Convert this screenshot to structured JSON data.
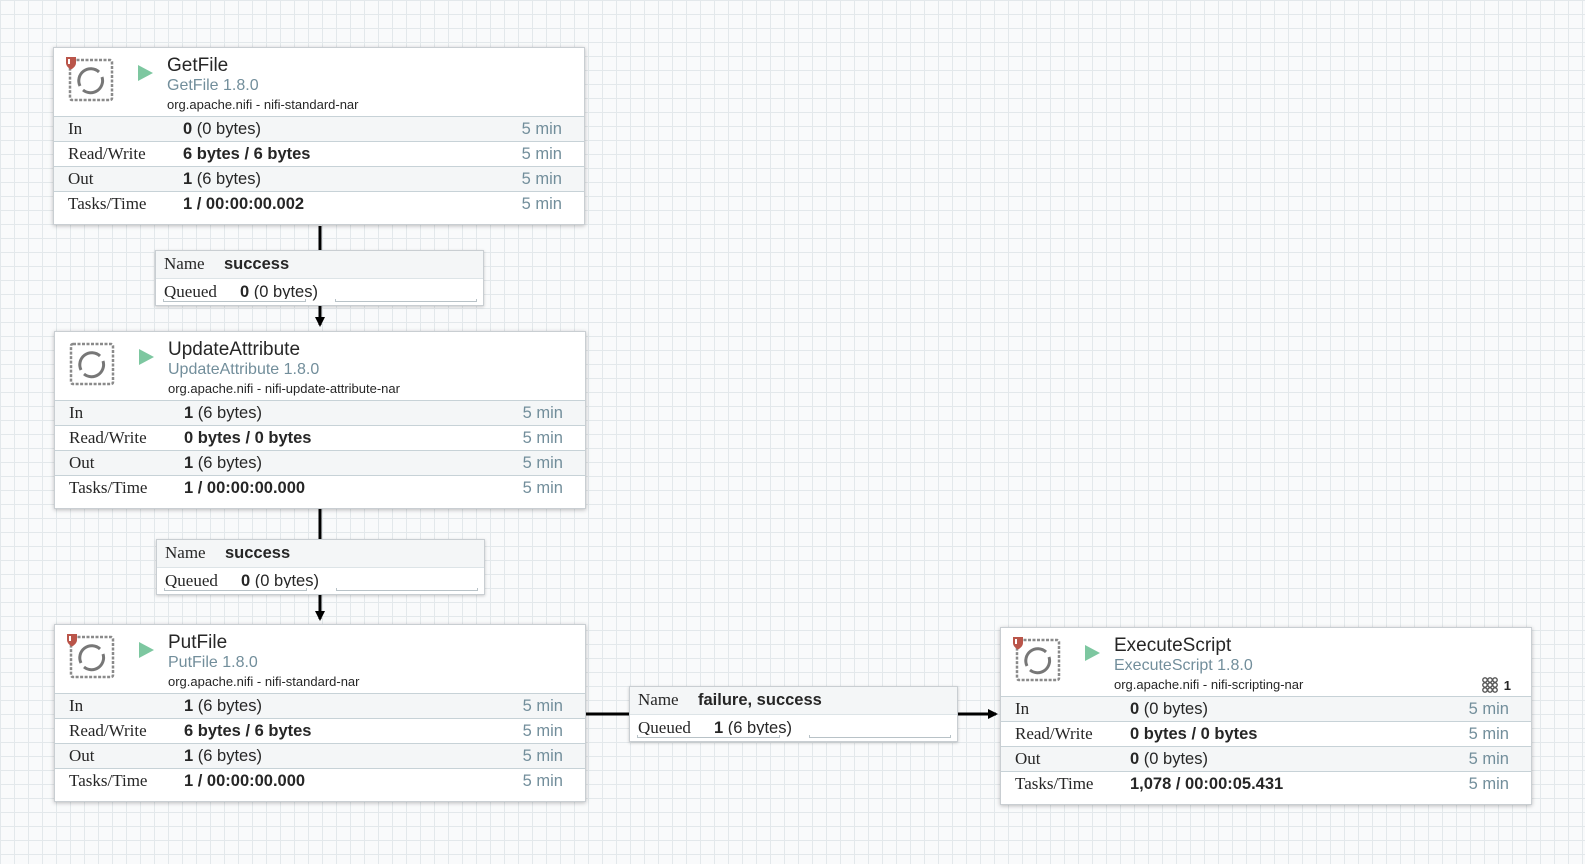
{
  "processors": [
    {
      "name": "GetFile",
      "type": "GetFile 1.8.0",
      "bundle": "org.apache.nifi - nifi-standard-nar",
      "restricted": true,
      "stats": {
        "in": {
          "label": "In",
          "count": "0",
          "size": "(0 bytes)",
          "window": "5 min"
        },
        "read_write": {
          "label": "Read/Write",
          "value": "6 bytes / 6 bytes",
          "window": "5 min"
        },
        "out": {
          "label": "Out",
          "count": "1",
          "size": "(6 bytes)",
          "window": "5 min"
        },
        "tasks_time": {
          "label": "Tasks/Time",
          "value": "1 / 00:00:00.002",
          "window": "5 min"
        }
      }
    },
    {
      "name": "UpdateAttribute",
      "type": "UpdateAttribute 1.8.0",
      "bundle": "org.apache.nifi - nifi-update-attribute-nar",
      "restricted": false,
      "stats": {
        "in": {
          "label": "In",
          "count": "1",
          "size": "(6 bytes)",
          "window": "5 min"
        },
        "read_write": {
          "label": "Read/Write",
          "value": "0 bytes / 0 bytes",
          "window": "5 min"
        },
        "out": {
          "label": "Out",
          "count": "1",
          "size": "(6 bytes)",
          "window": "5 min"
        },
        "tasks_time": {
          "label": "Tasks/Time",
          "value": "1 / 00:00:00.000",
          "window": "5 min"
        }
      }
    },
    {
      "name": "PutFile",
      "type": "PutFile 1.8.0",
      "bundle": "org.apache.nifi - nifi-standard-nar",
      "restricted": true,
      "stats": {
        "in": {
          "label": "In",
          "count": "1",
          "size": "(6 bytes)",
          "window": "5 min"
        },
        "read_write": {
          "label": "Read/Write",
          "value": "6 bytes / 6 bytes",
          "window": "5 min"
        },
        "out": {
          "label": "Out",
          "count": "1",
          "size": "(6 bytes)",
          "window": "5 min"
        },
        "tasks_time": {
          "label": "Tasks/Time",
          "value": "1 / 00:00:00.000",
          "window": "5 min"
        }
      }
    },
    {
      "name": "ExecuteScript",
      "type": "ExecuteScript 1.8.0",
      "bundle": "org.apache.nifi - nifi-scripting-nar",
      "restricted": true,
      "active_threads": "1",
      "stats": {
        "in": {
          "label": "In",
          "count": "0",
          "size": "(0 bytes)",
          "window": "5 min"
        },
        "read_write": {
          "label": "Read/Write",
          "value": "0 bytes / 0 bytes",
          "window": "5 min"
        },
        "out": {
          "label": "Out",
          "count": "0",
          "size": "(0 bytes)",
          "window": "5 min"
        },
        "tasks_time": {
          "label": "Tasks/Time",
          "value": "1,078 / 00:00:05.431",
          "window": "5 min"
        }
      }
    }
  ],
  "connections": [
    {
      "name_label": "Name",
      "name": "success",
      "queued_label": "Queued",
      "queued_count": "0",
      "queued_size": "(0 bytes)"
    },
    {
      "name_label": "Name",
      "name": "success",
      "queued_label": "Queued",
      "queued_count": "0",
      "queued_size": "(0 bytes)"
    },
    {
      "name_label": "Name",
      "name": "failure, success",
      "queued_label": "Queued",
      "queued_count": "1",
      "queued_size": "(6 bytes)"
    }
  ],
  "colors": {
    "canvas_bg": "#f9fafb",
    "grid_line": "#e3e8eb",
    "run_icon": "#7dc7a0",
    "restricted_icon": "#ba554a",
    "secondary_text": "#728e9b"
  },
  "icons": {
    "processor": "processor-icon",
    "running": "play-icon",
    "restricted": "restricted-shield-icon",
    "threads": "active-threads-icon"
  }
}
